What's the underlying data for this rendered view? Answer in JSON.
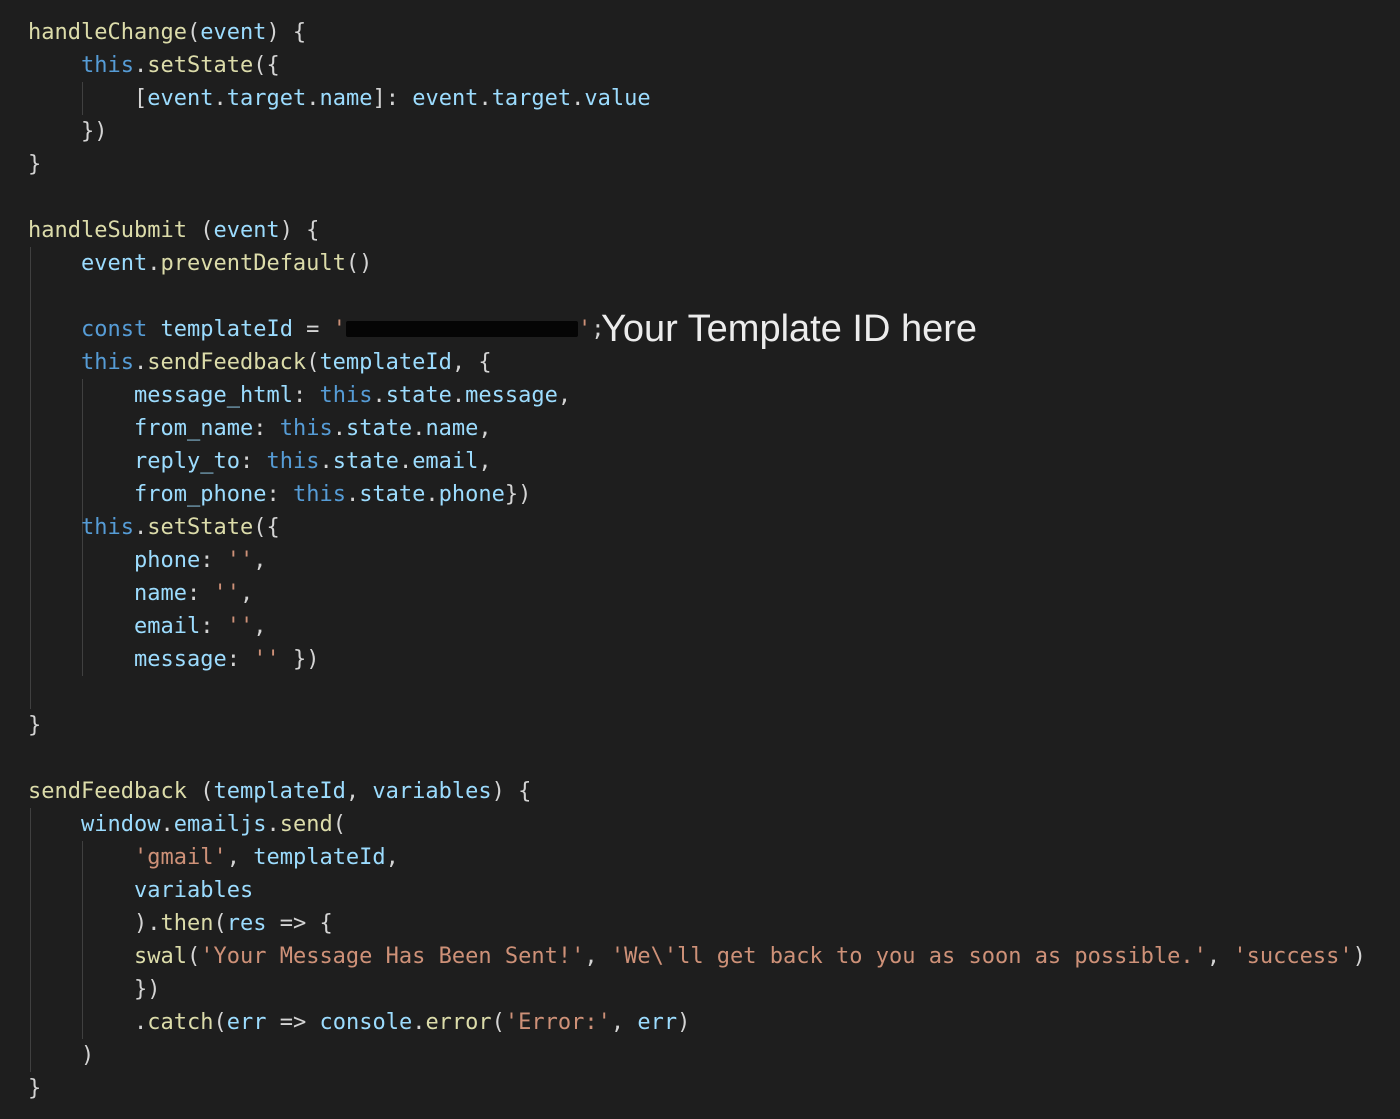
{
  "editor": {
    "theme_colors": {
      "background": "#1e1e1e",
      "plain": "#d4d4d4",
      "function": "#dcdcaa",
      "variable": "#9cdcfe",
      "keyword": "#569cd6",
      "string": "#ce9178",
      "indent_guide": "#404040",
      "redaction": "#050505"
    },
    "lines": [
      {
        "indent": 0,
        "tokens": [
          [
            "handleChange",
            "fn"
          ],
          [
            "(",
            ""
          ],
          [
            "event",
            "var"
          ],
          [
            ") {",
            ""
          ]
        ]
      },
      {
        "indent": 1,
        "tokens": [
          [
            "this",
            "kw"
          ],
          [
            ".",
            ""
          ],
          [
            "setState",
            "fn"
          ],
          [
            "({",
            ""
          ]
        ]
      },
      {
        "indent": 2,
        "tokens": [
          [
            "[",
            ""
          ],
          [
            "event",
            "var"
          ],
          [
            ".",
            ""
          ],
          [
            "target",
            "var"
          ],
          [
            ".",
            ""
          ],
          [
            "name",
            "var"
          ],
          [
            "]: ",
            ""
          ],
          [
            "event",
            "var"
          ],
          [
            ".",
            ""
          ],
          [
            "target",
            "var"
          ],
          [
            ".",
            ""
          ],
          [
            "value",
            "var"
          ]
        ]
      },
      {
        "indent": 1,
        "tokens": [
          [
            "})",
            ""
          ]
        ]
      },
      {
        "indent": 0,
        "tokens": [
          [
            "}",
            ""
          ]
        ]
      },
      {
        "indent": 0,
        "tokens": []
      },
      {
        "indent": 0,
        "tokens": [
          [
            "handleSubmit",
            "fn"
          ],
          [
            " (",
            ""
          ],
          [
            "event",
            "var"
          ],
          [
            ") {",
            ""
          ]
        ]
      },
      {
        "indent": 1,
        "tokens": [
          [
            "event",
            "var"
          ],
          [
            ".",
            ""
          ],
          [
            "preventDefault",
            "fn"
          ],
          [
            "()",
            ""
          ]
        ]
      },
      {
        "indent": 0,
        "tokens": []
      },
      {
        "indent": 1,
        "tokens": [
          [
            "const",
            "kw"
          ],
          [
            " ",
            ""
          ],
          [
            "templateId",
            "var"
          ],
          [
            " = ",
            ""
          ],
          [
            "'",
            "str"
          ],
          [
            "",
            "redact"
          ],
          [
            "'",
            "str"
          ],
          [
            ";",
            ""
          ]
        ]
      },
      {
        "indent": 1,
        "tokens": [
          [
            "this",
            "kw"
          ],
          [
            ".",
            ""
          ],
          [
            "sendFeedback",
            "fn"
          ],
          [
            "(",
            ""
          ],
          [
            "templateId",
            "var"
          ],
          [
            ", {",
            ""
          ]
        ]
      },
      {
        "indent": 2,
        "tokens": [
          [
            "message_html",
            "var"
          ],
          [
            ": ",
            ""
          ],
          [
            "this",
            "kw"
          ],
          [
            ".",
            ""
          ],
          [
            "state",
            "var"
          ],
          [
            ".",
            ""
          ],
          [
            "message",
            "var"
          ],
          [
            ",",
            ""
          ]
        ]
      },
      {
        "indent": 2,
        "tokens": [
          [
            "from_name",
            "var"
          ],
          [
            ": ",
            ""
          ],
          [
            "this",
            "kw"
          ],
          [
            ".",
            ""
          ],
          [
            "state",
            "var"
          ],
          [
            ".",
            ""
          ],
          [
            "name",
            "var"
          ],
          [
            ",",
            ""
          ]
        ]
      },
      {
        "indent": 2,
        "tokens": [
          [
            "reply_to",
            "var"
          ],
          [
            ": ",
            ""
          ],
          [
            "this",
            "kw"
          ],
          [
            ".",
            ""
          ],
          [
            "state",
            "var"
          ],
          [
            ".",
            ""
          ],
          [
            "email",
            "var"
          ],
          [
            ",",
            ""
          ]
        ]
      },
      {
        "indent": 2,
        "tokens": [
          [
            "from_phone",
            "var"
          ],
          [
            ": ",
            ""
          ],
          [
            "this",
            "kw"
          ],
          [
            ".",
            ""
          ],
          [
            "state",
            "var"
          ],
          [
            ".",
            ""
          ],
          [
            "phone",
            "var"
          ],
          [
            "})",
            ""
          ]
        ]
      },
      {
        "indent": 1,
        "tokens": [
          [
            "this",
            "kw"
          ],
          [
            ".",
            ""
          ],
          [
            "setState",
            "fn"
          ],
          [
            "({",
            ""
          ]
        ]
      },
      {
        "indent": 2,
        "tokens": [
          [
            "phone",
            "var"
          ],
          [
            ": ",
            ""
          ],
          [
            "''",
            "str"
          ],
          [
            ",",
            ""
          ]
        ]
      },
      {
        "indent": 2,
        "tokens": [
          [
            "name",
            "var"
          ],
          [
            ": ",
            ""
          ],
          [
            "''",
            "str"
          ],
          [
            ",",
            ""
          ]
        ]
      },
      {
        "indent": 2,
        "tokens": [
          [
            "email",
            "var"
          ],
          [
            ": ",
            ""
          ],
          [
            "''",
            "str"
          ],
          [
            ",",
            ""
          ]
        ]
      },
      {
        "indent": 2,
        "tokens": [
          [
            "message",
            "var"
          ],
          [
            ": ",
            ""
          ],
          [
            "''",
            "str"
          ],
          [
            " })",
            ""
          ]
        ]
      },
      {
        "indent": 0,
        "tokens": []
      },
      {
        "indent": 0,
        "tokens": [
          [
            "}",
            ""
          ]
        ]
      },
      {
        "indent": 0,
        "tokens": []
      },
      {
        "indent": 0,
        "tokens": [
          [
            "sendFeedback",
            "fn"
          ],
          [
            " (",
            ""
          ],
          [
            "templateId",
            "var"
          ],
          [
            ", ",
            ""
          ],
          [
            "variables",
            "var"
          ],
          [
            ") {",
            ""
          ]
        ]
      },
      {
        "indent": 1,
        "tokens": [
          [
            "window",
            "var"
          ],
          [
            ".",
            ""
          ],
          [
            "emailjs",
            "var"
          ],
          [
            ".",
            ""
          ],
          [
            "send",
            "fn"
          ],
          [
            "(",
            ""
          ]
        ]
      },
      {
        "indent": 2,
        "tokens": [
          [
            "'gmail'",
            "str"
          ],
          [
            ", ",
            ""
          ],
          [
            "templateId",
            "var"
          ],
          [
            ",",
            ""
          ]
        ]
      },
      {
        "indent": 2,
        "tokens": [
          [
            "variables",
            "var"
          ]
        ]
      },
      {
        "indent": 2,
        "tokens": [
          [
            ").",
            ""
          ],
          [
            "then",
            "fn"
          ],
          [
            "(",
            ""
          ],
          [
            "res",
            "var"
          ],
          [
            " => {",
            ""
          ]
        ]
      },
      {
        "indent": 2,
        "tokens": [
          [
            "swal",
            "fn"
          ],
          [
            "(",
            ""
          ],
          [
            "'Your Message Has Been Sent!'",
            "str"
          ],
          [
            ", ",
            ""
          ],
          [
            "'We\\'ll get back to you as soon as possible.'",
            "str"
          ],
          [
            ", ",
            ""
          ],
          [
            "'success'",
            "str"
          ],
          [
            ")",
            ""
          ]
        ]
      },
      {
        "indent": 2,
        "tokens": [
          [
            "})",
            ""
          ]
        ]
      },
      {
        "indent": 2,
        "tokens": [
          [
            ".",
            ""
          ],
          [
            "catch",
            "fn"
          ],
          [
            "(",
            ""
          ],
          [
            "err",
            "var"
          ],
          [
            " => ",
            ""
          ],
          [
            "console",
            "var"
          ],
          [
            ".",
            ""
          ],
          [
            "error",
            "fn"
          ],
          [
            "(",
            ""
          ],
          [
            "'Error:'",
            "str"
          ],
          [
            ", ",
            ""
          ],
          [
            "err",
            "var"
          ],
          [
            ")",
            ""
          ]
        ]
      },
      {
        "indent": 1,
        "tokens": [
          [
            ")",
            ""
          ]
        ]
      },
      {
        "indent": 0,
        "tokens": [
          [
            "}",
            ""
          ]
        ]
      }
    ],
    "annotation": "Your Template ID here"
  }
}
